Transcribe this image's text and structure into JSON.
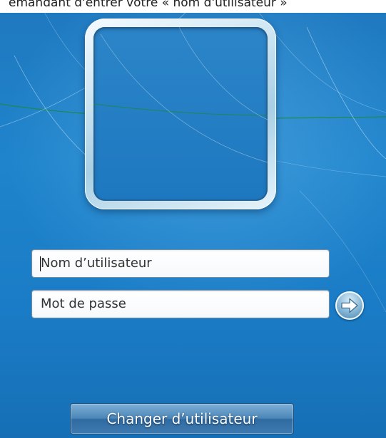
{
  "caption": "emandant d'entrer votre « nom d'utilisateur »",
  "login": {
    "username_placeholder": "Nom d’utilisateur",
    "password_placeholder": "Mot de passe",
    "switch_user_label": "Changer d’utilisateur"
  },
  "colors": {
    "background": "#1f7fc5",
    "button": "#3f7bb0"
  },
  "icons": {
    "submit": "arrow-right-circle-icon"
  }
}
